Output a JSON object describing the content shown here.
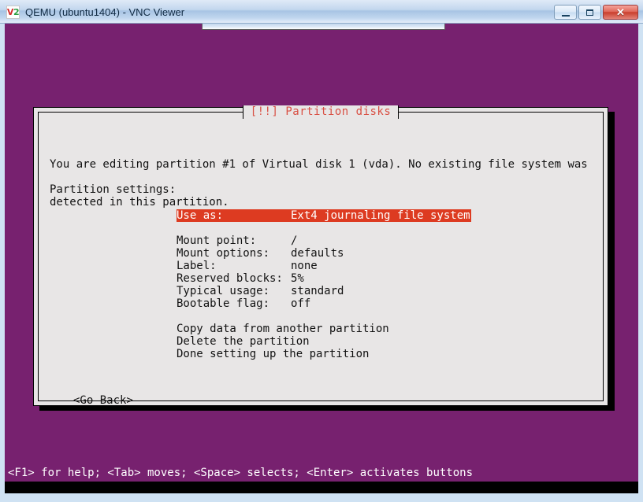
{
  "window": {
    "title": "QEMU (ubuntu1404) - VNC Viewer",
    "logo_left": "V",
    "logo_right": "2",
    "controls": {
      "minimize_label": "",
      "maximize_label": "",
      "close_label": "✕"
    }
  },
  "dialog": {
    "title": "[!!] Partition disks",
    "intro_line1": "You are editing partition #1 of Virtual disk 1 (vda). No existing file system was",
    "intro_line2": "detected in this partition.",
    "settings_heading": "Partition settings:",
    "selected_option": {
      "key": "Use as:",
      "value": "Ext4 journaling file system"
    },
    "options": [
      {
        "key": "Mount point:",
        "value": "/"
      },
      {
        "key": "Mount options:",
        "value": "defaults"
      },
      {
        "key": "Label:",
        "value": "none"
      },
      {
        "key": "Reserved blocks:",
        "value": "5%"
      },
      {
        "key": "Typical usage:",
        "value": "standard"
      },
      {
        "key": "Bootable flag:",
        "value": "off"
      }
    ],
    "actions": [
      "Copy data from another partition",
      "Delete the partition",
      "Done setting up the partition"
    ],
    "go_back": "<Go Back>"
  },
  "help_bar": {
    "text": "<F1> for help; <Tab> moves; <Space> selects; <Enter> activates buttons"
  },
  "colors": {
    "desktop_purple": "#77216f",
    "dialog_background": "#e8e6e6",
    "title_red": "#d94f43",
    "highlight_red": "#dd3b21",
    "text_black": "#121212",
    "help_text": "#ffffff"
  }
}
